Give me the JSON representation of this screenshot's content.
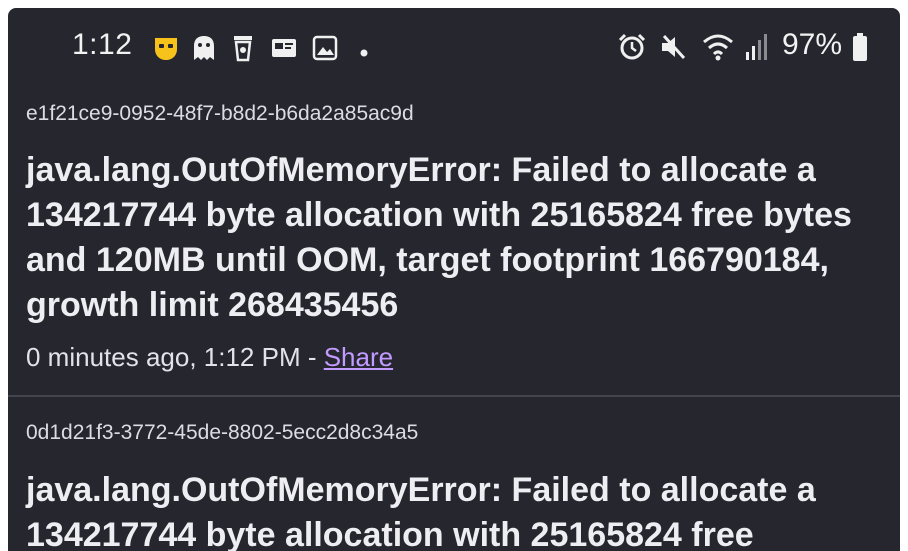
{
  "status_bar": {
    "time": "1:12",
    "left_icons": [
      "app-notification-icon",
      "ghost-icon",
      "cup-icon",
      "card-icon",
      "image-icon",
      "dot-icon"
    ],
    "right_icons": [
      "alarm-icon",
      "mute-icon",
      "wifi-icon",
      "signal-icon",
      "battery-icon"
    ],
    "battery_percent": "97%",
    "accent_color": "#f7c31a"
  },
  "entries": [
    {
      "id": "e1f21ce9-0952-48f7-b8d2-b6da2a85ac9d",
      "title": "java.lang.OutOfMemoryError: Failed to allocate a 134217744 byte allocation with 25165824 free bytes and 120MB until OOM, target footprint 166790184, growth limit 268435456",
      "time_ago": "0 minutes ago, 1:12 PM - ",
      "share_label": "Share"
    },
    {
      "id": "0d1d21f3-3772-45de-8802-5ecc2d8c34a5",
      "title": "java.lang.OutOfMemoryError: Failed to allocate a 134217744 byte allocation with 25165824 free"
    }
  ],
  "colors": {
    "background": "#26262f",
    "link": "#c19bff",
    "divider": "#44444e"
  }
}
